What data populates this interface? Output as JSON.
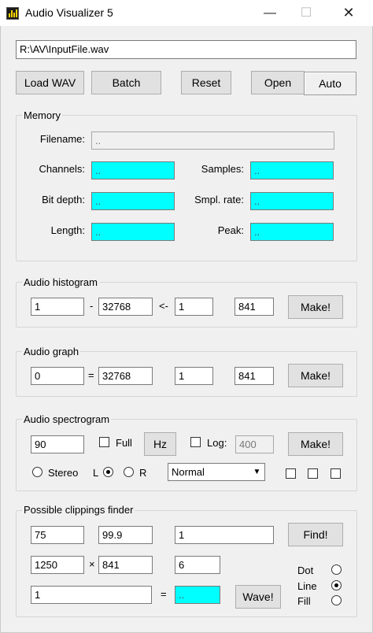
{
  "window": {
    "title": "Audio Visualizer 5",
    "minimize": "—",
    "maximize": "☐",
    "close": "✕"
  },
  "top": {
    "file_path": "R:\\AV\\InputFile.wav",
    "load_wav": "Load WAV",
    "batch": "Batch",
    "reset": "Reset",
    "open": "Open",
    "auto": "Auto"
  },
  "memory": {
    "title": "Memory",
    "filename_label": "Filename:",
    "filename_value": "..",
    "channels_label": "Channels:",
    "channels_value": "..",
    "samples_label": "Samples:",
    "samples_value": "..",
    "bitdepth_label": "Bit depth:",
    "bitdepth_value": "..",
    "smplrate_label": "Smpl. rate:",
    "smplrate_value": "..",
    "length_label": "Length:",
    "length_value": "..",
    "peak_label": "Peak:",
    "peak_value": ".."
  },
  "histogram": {
    "title": "Audio histogram",
    "from": "1",
    "dash": "-",
    "to": "32768",
    "arrow": "<-",
    "step": "1",
    "height": "841",
    "make": "Make!"
  },
  "graph": {
    "title": "Audio graph",
    "from": "0",
    "eq": "=",
    "to": "32768",
    "step": "1",
    "height": "841",
    "make": "Make!"
  },
  "spectrogram": {
    "title": "Audio spectrogram",
    "value": "90",
    "full_label": "Full",
    "hz": "Hz",
    "log_label": "Log:",
    "log_value": "400",
    "make": "Make!",
    "stereo_label": "Stereo",
    "l_label": "L",
    "r_label": "R",
    "mode_selected": "Normal",
    "dropdown_arrow": "▼"
  },
  "clippings": {
    "title": "Possible clippings finder",
    "v1": "75",
    "v2": "99.9",
    "v3": "1",
    "find": "Find!",
    "w": "1250",
    "times": "×",
    "h": "841",
    "v4": "6",
    "v5": "1",
    "eq": "=",
    "result": "..",
    "wave": "Wave!",
    "dot_label": "Dot",
    "line_label": "Line",
    "fill_label": "Fill"
  }
}
